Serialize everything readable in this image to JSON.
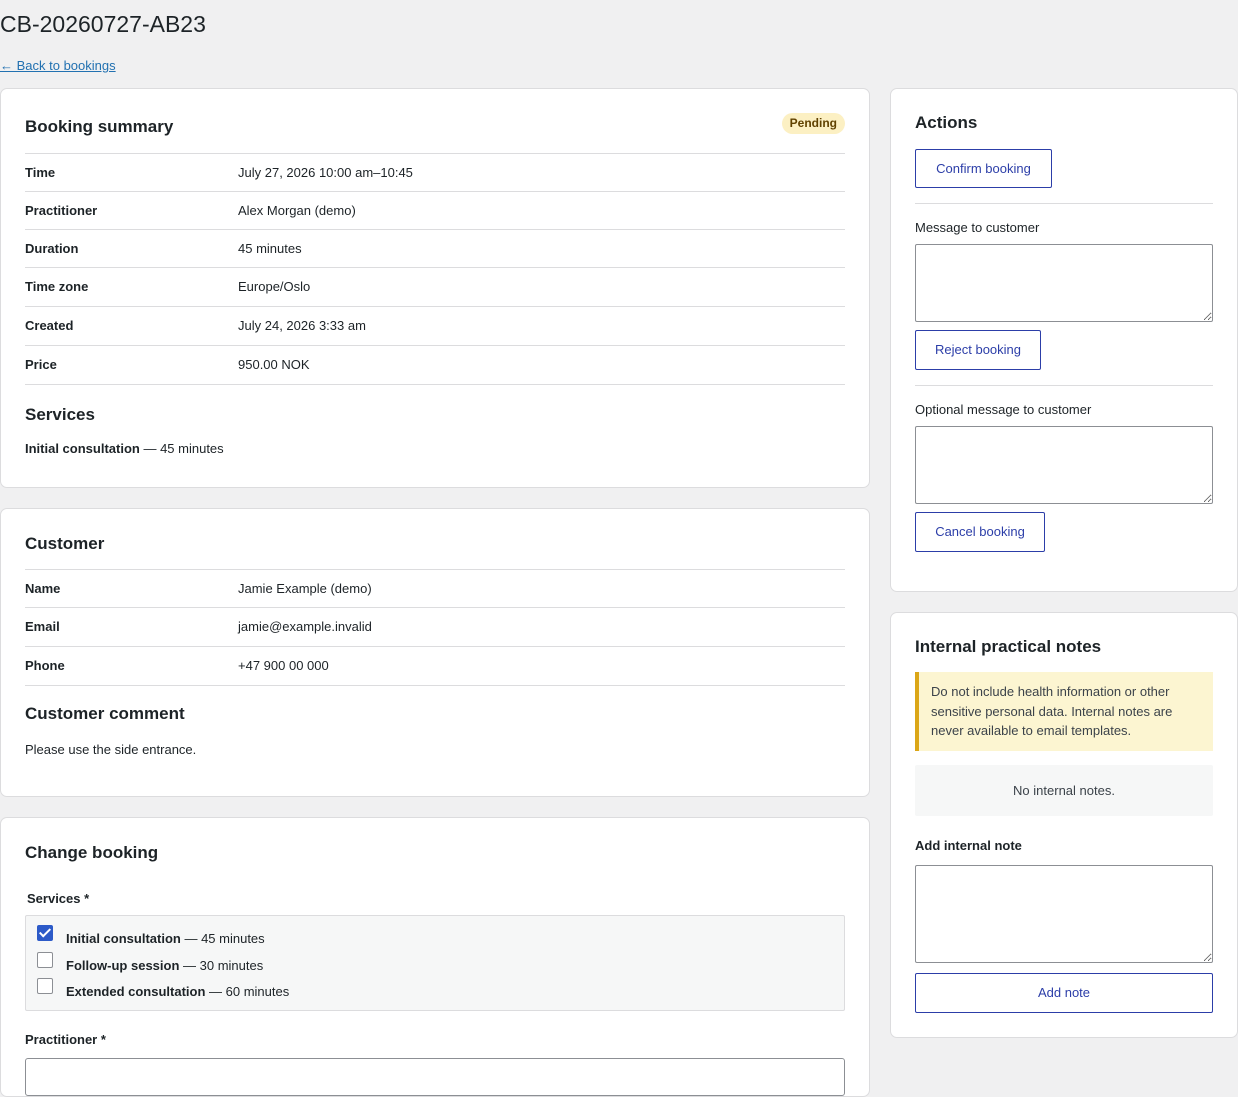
{
  "page": {
    "title": "CB-20260727-AB23",
    "back_link": "← Back to bookings"
  },
  "summary": {
    "heading": "Booking summary",
    "status": "Pending",
    "rows": [
      {
        "label": "Time",
        "value": "July 27, 2026 10:00 am–10:45"
      },
      {
        "label": "Practitioner",
        "value": "Alex Morgan (demo)"
      },
      {
        "label": "Duration",
        "value": "45 minutes"
      },
      {
        "label": "Time zone",
        "value": "Europe/Oslo"
      },
      {
        "label": "Created",
        "value": "July 24, 2026 3:33 am"
      },
      {
        "label": "Price",
        "value": "950.00 NOK"
      }
    ],
    "services_heading": "Services",
    "service_name": "Initial consultation",
    "service_duration": " — 45 minutes"
  },
  "customer": {
    "heading": "Customer",
    "rows": [
      {
        "label": "Name",
        "value": "Jamie Example (demo)"
      },
      {
        "label": "Email",
        "value": "jamie@example.invalid"
      },
      {
        "label": "Phone",
        "value": "+47 900 00 000"
      }
    ],
    "comment_heading": "Customer comment",
    "comment": "Please use the side entrance."
  },
  "change": {
    "heading": "Change booking",
    "services_label": "Services *",
    "services": [
      {
        "name": "Initial consultation",
        "duration": " — 45 minutes",
        "checked": true
      },
      {
        "name": "Follow-up session",
        "duration": " — 30 minutes",
        "checked": false
      },
      {
        "name": "Extended consultation",
        "duration": " — 60 minutes",
        "checked": false
      }
    ],
    "practitioner_label": "Practitioner *"
  },
  "actions": {
    "heading": "Actions",
    "confirm_label": "Confirm booking",
    "message_label": "Message to customer",
    "reject_label": "Reject booking",
    "optional_message_label": "Optional message to customer",
    "cancel_label": "Cancel booking"
  },
  "notes": {
    "heading": "Internal practical notes",
    "warning": "Do not include health information or other sensitive personal data. Internal notes are never available to email templates.",
    "empty": "No internal notes.",
    "add_label": "Add internal note",
    "add_button": "Add note"
  },
  "colors": {
    "accent": "#2c3ea8",
    "badge_bg": "#fcf0c3",
    "warning_border": "#dba617"
  }
}
